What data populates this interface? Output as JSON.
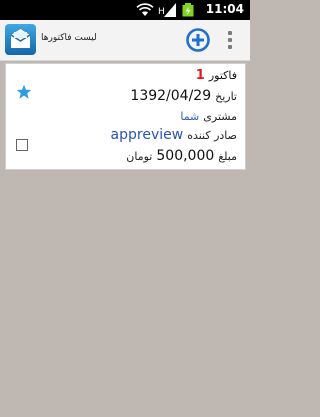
{
  "status_bar": {
    "time": "11:04",
    "network_label": "H"
  },
  "app_bar": {
    "title": "لیست فاکتورها"
  },
  "invoice": {
    "invoice_label": "فاکتور",
    "invoice_number": "1",
    "date_label": "تاریخ",
    "date_value": "1392/04/29",
    "customer_label": "مشتری",
    "customer_value": "شما",
    "issuer_label": "صادر کننده",
    "issuer_value": "appreview",
    "amount_label": "مبلغ",
    "amount_value": "500,000",
    "currency": "تومان",
    "starred": true,
    "checked": false
  },
  "colors": {
    "accent_blue": "#1f6fd0",
    "invoice_number_red": "#e01b1b",
    "star_blue": "#2f9ce0"
  }
}
